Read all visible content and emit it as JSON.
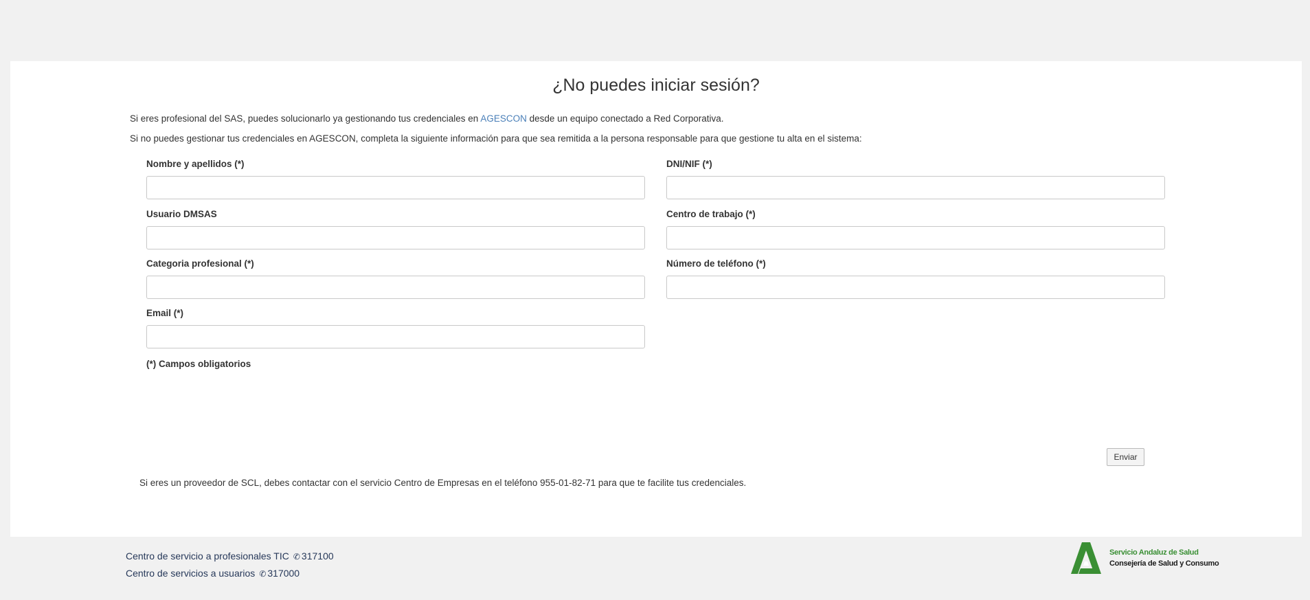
{
  "page": {
    "title": "¿No puedes iniciar sesión?",
    "intro_1_before": "Si eres profesional del SAS, puedes solucionarlo ya gestionando tus credenciales en ",
    "intro_1_link": "AGESCON",
    "intro_1_after": " desde un equipo conectado a Red Corporativa.",
    "intro_2": "Si no puedes gestionar tus credenciales en AGESCON, completa la siguiente información para que sea remitida a la persona responsable para que gestione tu alta en el sistema:"
  },
  "form": {
    "fields": [
      {
        "label": "Nombre y apellidos (*)",
        "value": "",
        "placeholder": ""
      },
      {
        "label": "DNI/NIF (*)",
        "value": "",
        "placeholder": ""
      },
      {
        "label": "Usuario DMSAS",
        "value": "",
        "placeholder": ""
      },
      {
        "label": "Centro de trabajo (*)",
        "value": "",
        "placeholder": ""
      },
      {
        "label": "Categoria profesional (*)",
        "value": "",
        "placeholder": ""
      },
      {
        "label": "Número de teléfono (*)",
        "value": "",
        "placeholder": ""
      },
      {
        "label": "Email (*)",
        "value": "",
        "placeholder": ""
      }
    ],
    "required_note": "(*) Campos obligatorios",
    "submit_label": "Enviar"
  },
  "provider_note": "Si eres un proveedor de SCL, debes contactar con el servicio Centro de Empresas en el teléfono 955-01-82-71 para que te facilite tus credenciales.",
  "footer": {
    "line_1_text": "Centro de servicio a profesionales TIC",
    "line_1_phone": "317100",
    "line_2_text": "Centro de servicios a usuarios",
    "line_2_phone": "317000",
    "phone_icon": "phone-icon",
    "logo_line_1": "Servicio Andaluz de Salud",
    "logo_line_2": "Consejería de Salud y Consumo"
  },
  "colors": {
    "background": "#f1f1f1",
    "card": "#ffffff",
    "link": "#4a7fb8",
    "footer_text": "#263859",
    "logo_green": "#3a8f34"
  }
}
